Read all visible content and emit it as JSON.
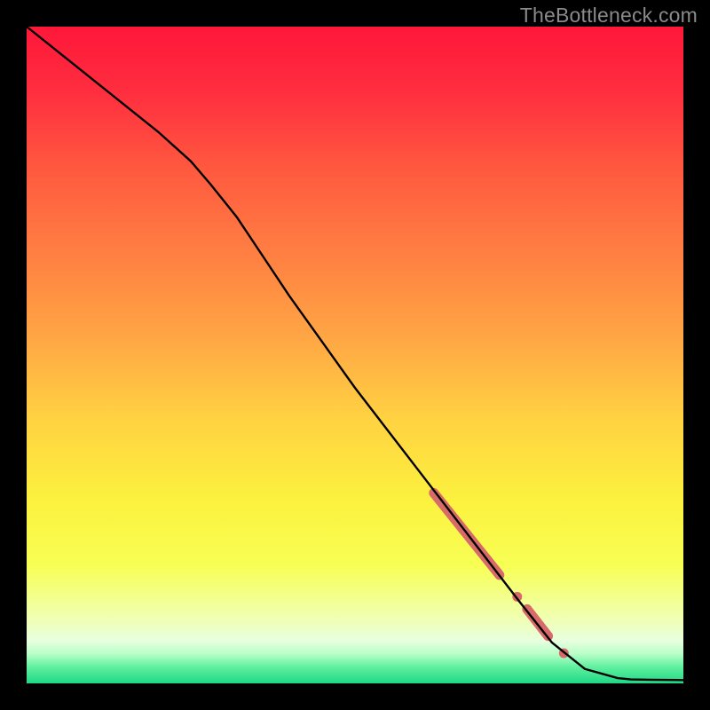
{
  "watermark": "TheBottleneck.com",
  "gradient": {
    "stops": [
      {
        "offset": 0.0,
        "color": "#ff173a"
      },
      {
        "offset": 0.1,
        "color": "#ff2e3f"
      },
      {
        "offset": 0.22,
        "color": "#ff5a3f"
      },
      {
        "offset": 0.35,
        "color": "#ff8042"
      },
      {
        "offset": 0.48,
        "color": "#ffa844"
      },
      {
        "offset": 0.6,
        "color": "#ffd341"
      },
      {
        "offset": 0.72,
        "color": "#fcf13e"
      },
      {
        "offset": 0.82,
        "color": "#f7ff54"
      },
      {
        "offset": 0.9,
        "color": "#f0ffb0"
      },
      {
        "offset": 0.935,
        "color": "#e8ffe0"
      },
      {
        "offset": 0.955,
        "color": "#b8ffc8"
      },
      {
        "offset": 0.975,
        "color": "#60f0a0"
      },
      {
        "offset": 1.0,
        "color": "#1fd885"
      }
    ]
  },
  "chart_data": {
    "type": "line",
    "title": "",
    "xlabel": "",
    "ylabel": "",
    "xlim": [
      0,
      100
    ],
    "ylim": [
      0,
      100
    ],
    "series": [
      {
        "name": "curve",
        "x": [
          0,
          5,
          10,
          15,
          20,
          25,
          28,
          32,
          36,
          40,
          45,
          50,
          55,
          60,
          65,
          70,
          75,
          80,
          85,
          90,
          92,
          95,
          100
        ],
        "y": [
          100,
          96,
          92,
          88,
          84,
          79.5,
          76,
          71,
          65,
          59,
          52,
          45,
          38.5,
          32,
          25.5,
          19,
          12.5,
          6.2,
          2.2,
          0.8,
          0.6,
          0.55,
          0.5
        ]
      }
    ],
    "highlights": [
      {
        "type": "segment",
        "x0": 62,
        "y0": 29,
        "x1": 72,
        "y1": 16.5,
        "width": 11
      },
      {
        "type": "dot",
        "x": 74.7,
        "y": 13.2,
        "r": 5.5
      },
      {
        "type": "segment",
        "x0": 76.2,
        "y0": 11.3,
        "x1": 79.4,
        "y1": 7.2,
        "width": 11
      },
      {
        "type": "dot",
        "x": 81.8,
        "y": 4.6,
        "r": 5.5
      }
    ],
    "highlight_color": "#d96a6a"
  }
}
